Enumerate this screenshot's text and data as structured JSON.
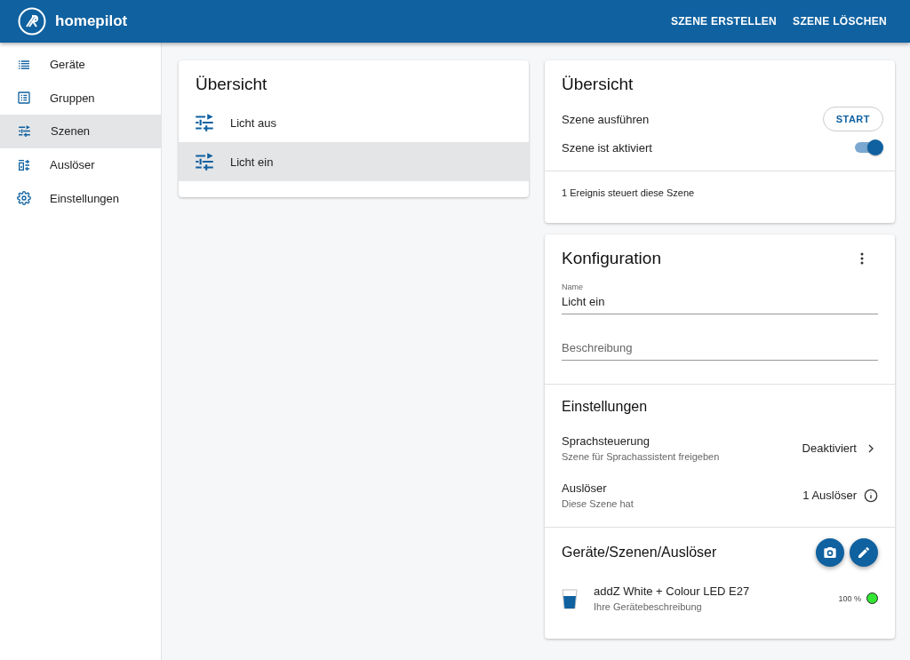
{
  "app_bar": {
    "title": "homepilot",
    "actions": [
      "SZENE ERSTELLEN",
      "SZENE LÖSCHEN"
    ]
  },
  "sidebar": {
    "items": [
      {
        "label": "Geräte",
        "selected": false
      },
      {
        "label": "Gruppen",
        "selected": false
      },
      {
        "label": "Szenen",
        "selected": true
      },
      {
        "label": "Auslöser",
        "selected": false
      },
      {
        "label": "Einstellungen",
        "selected": false
      }
    ]
  },
  "scene_list": {
    "title": "Übersicht",
    "items": [
      {
        "label": "Licht aus",
        "selected": false
      },
      {
        "label": "Licht ein",
        "selected": true
      }
    ]
  },
  "overview": {
    "title": "Übersicht",
    "run_label": "Szene ausführen",
    "start_button": "START",
    "active_label": "Szene ist aktiviert",
    "active_on": true,
    "event_info": "1 Ereignis steuert diese Szene"
  },
  "configuration": {
    "title": "Konfiguration",
    "name_field": {
      "label": "Name",
      "value": "Licht ein"
    },
    "description_field": {
      "placeholder": "Beschreibung"
    },
    "settings_title": "Einstellungen",
    "settings": [
      {
        "kind": "link",
        "title": "Sprachsteuerung",
        "subtitle": "Szene für Sprachassistent freigeben",
        "value": "Deaktiviert"
      },
      {
        "kind": "info",
        "title": "Auslöser",
        "subtitle": "Diese Szene hat",
        "value": "1 Auslöser"
      }
    ],
    "devices_title": "Geräte/Szenen/Auslöser",
    "devices": [
      {
        "name": "addZ White + Colour LED E27",
        "description": "Ihre Gerätebeschreibung",
        "reading": "100 %",
        "color": "#33e633"
      }
    ]
  }
}
